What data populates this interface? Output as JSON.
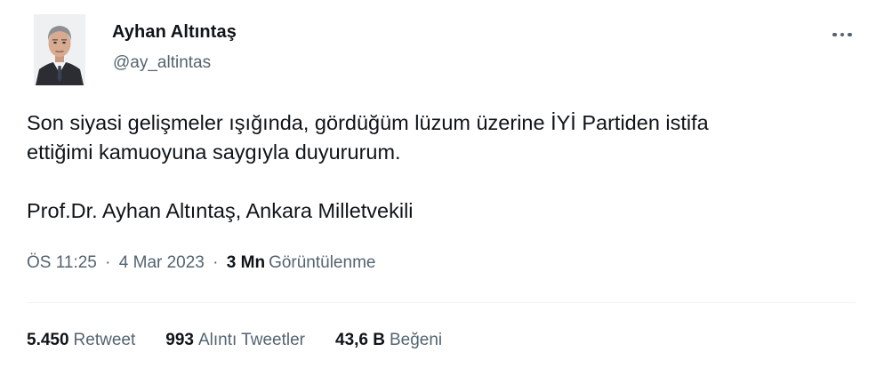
{
  "author": {
    "name": "Ayhan Altıntaş",
    "handle": "@ay_altintas"
  },
  "tweet": {
    "line1": "Son siyasi gelişmeler ışığında, gördüğüm lüzum üzerine İYİ Partiden istifa",
    "line2": "ettiğimi kamuoyuna saygıyla duyururum.",
    "signature": "Prof.Dr. Ayhan Altıntaş,  Ankara Milletvekili"
  },
  "meta": {
    "time": "ÖS 11:25",
    "separator": "·",
    "date": "4 Mar 2023",
    "views_count": "3 Mn",
    "views_label": "Görüntülenme"
  },
  "stats": {
    "retweets_count": "5.450",
    "retweets_label": "Retweet",
    "quotes_count": "993",
    "quotes_label": "Alıntı Tweetler",
    "likes_count": "43,6 B",
    "likes_label": "Beğeni"
  },
  "icons": {
    "more": "more-horizontal-icon"
  },
  "colors": {
    "primary_text": "#0f1419",
    "secondary_text": "#536471",
    "divider": "#eff3f4"
  }
}
